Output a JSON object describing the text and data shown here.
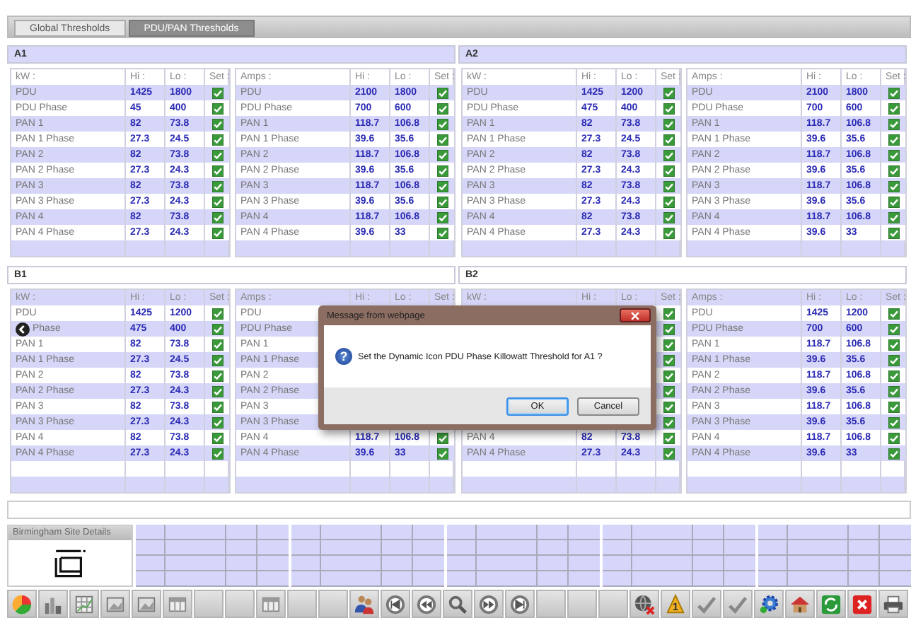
{
  "tabs": [
    {
      "label": "Global Thresholds",
      "selected": false
    },
    {
      "label": "PDU/PAN Thresholds",
      "selected": true
    }
  ],
  "sections": [
    {
      "title": "A1",
      "highlighted": true,
      "header_shaded": false,
      "tables": [
        {
          "columns": [
            "kW :",
            "Hi :",
            "Lo :",
            "Set :"
          ],
          "rows": [
            {
              "label": "PDU",
              "hi": "1425",
              "lo": "1800",
              "set": true
            },
            {
              "label": "PDU Phase",
              "hi": "45",
              "lo": "400",
              "set": true
            },
            {
              "label": "PAN 1",
              "hi": "82",
              "lo": "73.8",
              "set": true
            },
            {
              "label": "PAN 1 Phase",
              "hi": "27.3",
              "lo": "24.5",
              "set": true
            },
            {
              "label": "PAN 2",
              "hi": "82",
              "lo": "73.8",
              "set": true
            },
            {
              "label": "PAN 2 Phase",
              "hi": "27.3",
              "lo": "24.3",
              "set": true
            },
            {
              "label": "PAN 3",
              "hi": "82",
              "lo": "73.8",
              "set": true
            },
            {
              "label": "PAN 3 Phase",
              "hi": "27.3",
              "lo": "24.3",
              "set": true
            },
            {
              "label": "PAN 4",
              "hi": "82",
              "lo": "73.8",
              "set": true
            },
            {
              "label": "PAN 4 Phase",
              "hi": "27.3",
              "lo": "24.3",
              "set": true
            },
            {
              "kind": "blank"
            }
          ]
        },
        {
          "columns": [
            "Amps :",
            "Hi :",
            "Lo :",
            "Set :"
          ],
          "rows": [
            {
              "label": "PDU",
              "hi": "2100",
              "lo": "1800",
              "set": true
            },
            {
              "label": "PDU Phase",
              "hi": "700",
              "lo": "600",
              "set": true
            },
            {
              "label": "PAN 1",
              "hi": "118.7",
              "lo": "106.8",
              "set": true
            },
            {
              "label": "PAN 1 Phase",
              "hi": "39.6",
              "lo": "35.6",
              "set": true
            },
            {
              "label": "PAN 2",
              "hi": "118.7",
              "lo": "106.8",
              "set": true
            },
            {
              "label": "PAN 2 Phase",
              "hi": "39.6",
              "lo": "35.6",
              "set": true
            },
            {
              "label": "PAN 3",
              "hi": "118.7",
              "lo": "106.8",
              "set": true
            },
            {
              "label": "PAN 3 Phase",
              "hi": "39.6",
              "lo": "35.6",
              "set": true
            },
            {
              "label": "PAN 4",
              "hi": "118.7",
              "lo": "106.8",
              "set": true
            },
            {
              "label": "PAN 4 Phase",
              "hi": "39.6",
              "lo": "33",
              "set": true
            },
            {
              "kind": "blank"
            }
          ]
        }
      ]
    },
    {
      "title": "A2",
      "highlighted": true,
      "header_shaded": false,
      "tables": [
        {
          "columns": [
            "kW :",
            "Hi :",
            "Lo :",
            "Set :"
          ],
          "rows": [
            {
              "label": "PDU",
              "hi": "1425",
              "lo": "1200",
              "set": true
            },
            {
              "label": "PDU Phase",
              "hi": "475",
              "lo": "400",
              "set": true
            },
            {
              "label": "PAN 1",
              "hi": "82",
              "lo": "73.8",
              "set": true
            },
            {
              "label": "PAN 1 Phase",
              "hi": "27.3",
              "lo": "24.5",
              "set": true
            },
            {
              "label": "PAN 2",
              "hi": "82",
              "lo": "73.8",
              "set": true
            },
            {
              "label": "PAN 2 Phase",
              "hi": "27.3",
              "lo": "24.3",
              "set": true
            },
            {
              "label": "PAN 3",
              "hi": "82",
              "lo": "73.8",
              "set": true
            },
            {
              "label": "PAN 3 Phase",
              "hi": "27.3",
              "lo": "24.3",
              "set": true
            },
            {
              "label": "PAN 4",
              "hi": "82",
              "lo": "73.8",
              "set": true
            },
            {
              "label": "PAN 4 Phase",
              "hi": "27.3",
              "lo": "24.3",
              "set": true
            },
            {
              "kind": "blank"
            }
          ]
        },
        {
          "columns": [
            "Amps :",
            "Hi :",
            "Lo :",
            "Set :"
          ],
          "rows": [
            {
              "label": "PDU",
              "hi": "2100",
              "lo": "1800",
              "set": true
            },
            {
              "label": "PDU Phase",
              "hi": "700",
              "lo": "600",
              "set": true
            },
            {
              "label": "PAN 1",
              "hi": "118.7",
              "lo": "106.8",
              "set": true
            },
            {
              "label": "PAN 1 Phase",
              "hi": "39.6",
              "lo": "35.6",
              "set": true
            },
            {
              "label": "PAN 2",
              "hi": "118.7",
              "lo": "106.8",
              "set": true
            },
            {
              "label": "PAN 2 Phase",
              "hi": "39.6",
              "lo": "35.6",
              "set": true
            },
            {
              "label": "PAN 3",
              "hi": "118.7",
              "lo": "106.8",
              "set": true
            },
            {
              "label": "PAN 3 Phase",
              "hi": "39.6",
              "lo": "35.6",
              "set": true
            },
            {
              "label": "PAN 4",
              "hi": "118.7",
              "lo": "106.8",
              "set": true
            },
            {
              "label": "PAN 4 Phase",
              "hi": "39.6",
              "lo": "33",
              "set": true
            },
            {
              "kind": "blank"
            }
          ]
        }
      ]
    },
    {
      "title": "B1",
      "highlighted": false,
      "header_shaded": true,
      "tables": [
        {
          "columns": [
            "kW :",
            "Hi :",
            "Lo :",
            "Set :"
          ],
          "rows": [
            {
              "label": "PDU",
              "hi": "1425",
              "lo": "1200",
              "set": true
            },
            {
              "kind": "back",
              "label": "Phase",
              "hi": "475",
              "lo": "400",
              "set": true
            },
            {
              "label": "PAN 1",
              "hi": "82",
              "lo": "73.8",
              "set": true
            },
            {
              "label": "PAN 1 Phase",
              "hi": "27.3",
              "lo": "24.5",
              "set": true
            },
            {
              "label": "PAN 2",
              "hi": "82",
              "lo": "73.8",
              "set": true
            },
            {
              "label": "PAN 2 Phase",
              "hi": "27.3",
              "lo": "24.3",
              "set": true
            },
            {
              "label": "PAN 3",
              "hi": "82",
              "lo": "73.8",
              "set": true
            },
            {
              "label": "PAN 3 Phase",
              "hi": "27.3",
              "lo": "24.3",
              "set": true
            },
            {
              "label": "PAN 4",
              "hi": "82",
              "lo": "73.8",
              "set": true
            },
            {
              "label": "PAN 4 Phase",
              "hi": "27.3",
              "lo": "24.3",
              "set": true
            },
            {
              "kind": "blank"
            },
            {
              "kind": "blank"
            }
          ]
        },
        {
          "columns": [
            "Amps :",
            "Hi :",
            "Lo :",
            "Set :"
          ],
          "rows": [
            {
              "label": "PDU"
            },
            {
              "label": "PDU Phase"
            },
            {
              "label": "PAN 1"
            },
            {
              "label": "PAN 1 Phase"
            },
            {
              "label": "PAN 2"
            },
            {
              "label": "PAN 2 Phase"
            },
            {
              "label": "PAN 3"
            },
            {
              "label": "PAN 3 Phase"
            },
            {
              "label": "PAN 4",
              "hi": "118.7",
              "lo": "106.8",
              "set": true
            },
            {
              "label": "PAN 4 Phase",
              "hi": "39.6",
              "lo": "33",
              "set": true
            },
            {
              "kind": "blank"
            },
            {
              "kind": "blank"
            }
          ]
        }
      ]
    },
    {
      "title": "B2",
      "highlighted": false,
      "header_shaded": true,
      "tables": [
        {
          "columns": [
            "kW :",
            "Hi :",
            "Lo :",
            "Set :"
          ],
          "rows": [
            {
              "set": true
            },
            {
              "set": true
            },
            {
              "set": true
            },
            {
              "set": true
            },
            {
              "set": true
            },
            {
              "set": true
            },
            {
              "set": true
            },
            {
              "set": true
            },
            {
              "label": "PAN 4",
              "hi": "82",
              "lo": "73.8",
              "set": true
            },
            {
              "label": "PAN 4 Phase",
              "hi": "27.3",
              "lo": "24.3",
              "set": true
            },
            {
              "kind": "blank"
            },
            {
              "kind": "blank"
            }
          ]
        },
        {
          "columns": [
            "Amps :",
            "Hi :",
            "Lo :",
            "Set :"
          ],
          "rows": [
            {
              "label": "PDU",
              "hi": "1425",
              "lo": "1200",
              "set": true
            },
            {
              "label": "PDU Phase",
              "hi": "700",
              "lo": "600",
              "set": true
            },
            {
              "label": "PAN 1",
              "hi": "118.7",
              "lo": "106.8",
              "set": true
            },
            {
              "label": "PAN 1 Phase",
              "hi": "39.6",
              "lo": "35.6",
              "set": true
            },
            {
              "label": "PAN 2",
              "hi": "118.7",
              "lo": "106.8",
              "set": true
            },
            {
              "label": "PAN 2 Phase",
              "hi": "39.6",
              "lo": "35.6",
              "set": true
            },
            {
              "label": "PAN 3",
              "hi": "118.7",
              "lo": "106.8",
              "set": true
            },
            {
              "label": "PAN 3 Phase",
              "hi": "39.6",
              "lo": "35.6",
              "set": true
            },
            {
              "label": "PAN 4",
              "hi": "118.7",
              "lo": "106.8",
              "set": true
            },
            {
              "label": "PAN 4 Phase",
              "hi": "39.6",
              "lo": "33",
              "set": true
            },
            {
              "kind": "blank"
            },
            {
              "kind": "blank"
            }
          ]
        }
      ]
    }
  ],
  "site_details": {
    "title": "Birmingham Site Details"
  },
  "toolbar": {
    "alert_badge": "1"
  },
  "dialog": {
    "title": "Message from webpage",
    "icon": "?",
    "message": "Set the Dynamic Icon PDU Phase Killowatt Threshold for A1 ?",
    "buttons": [
      {
        "label": "OK",
        "selected": true
      },
      {
        "label": "Cancel",
        "selected": false
      }
    ]
  }
}
